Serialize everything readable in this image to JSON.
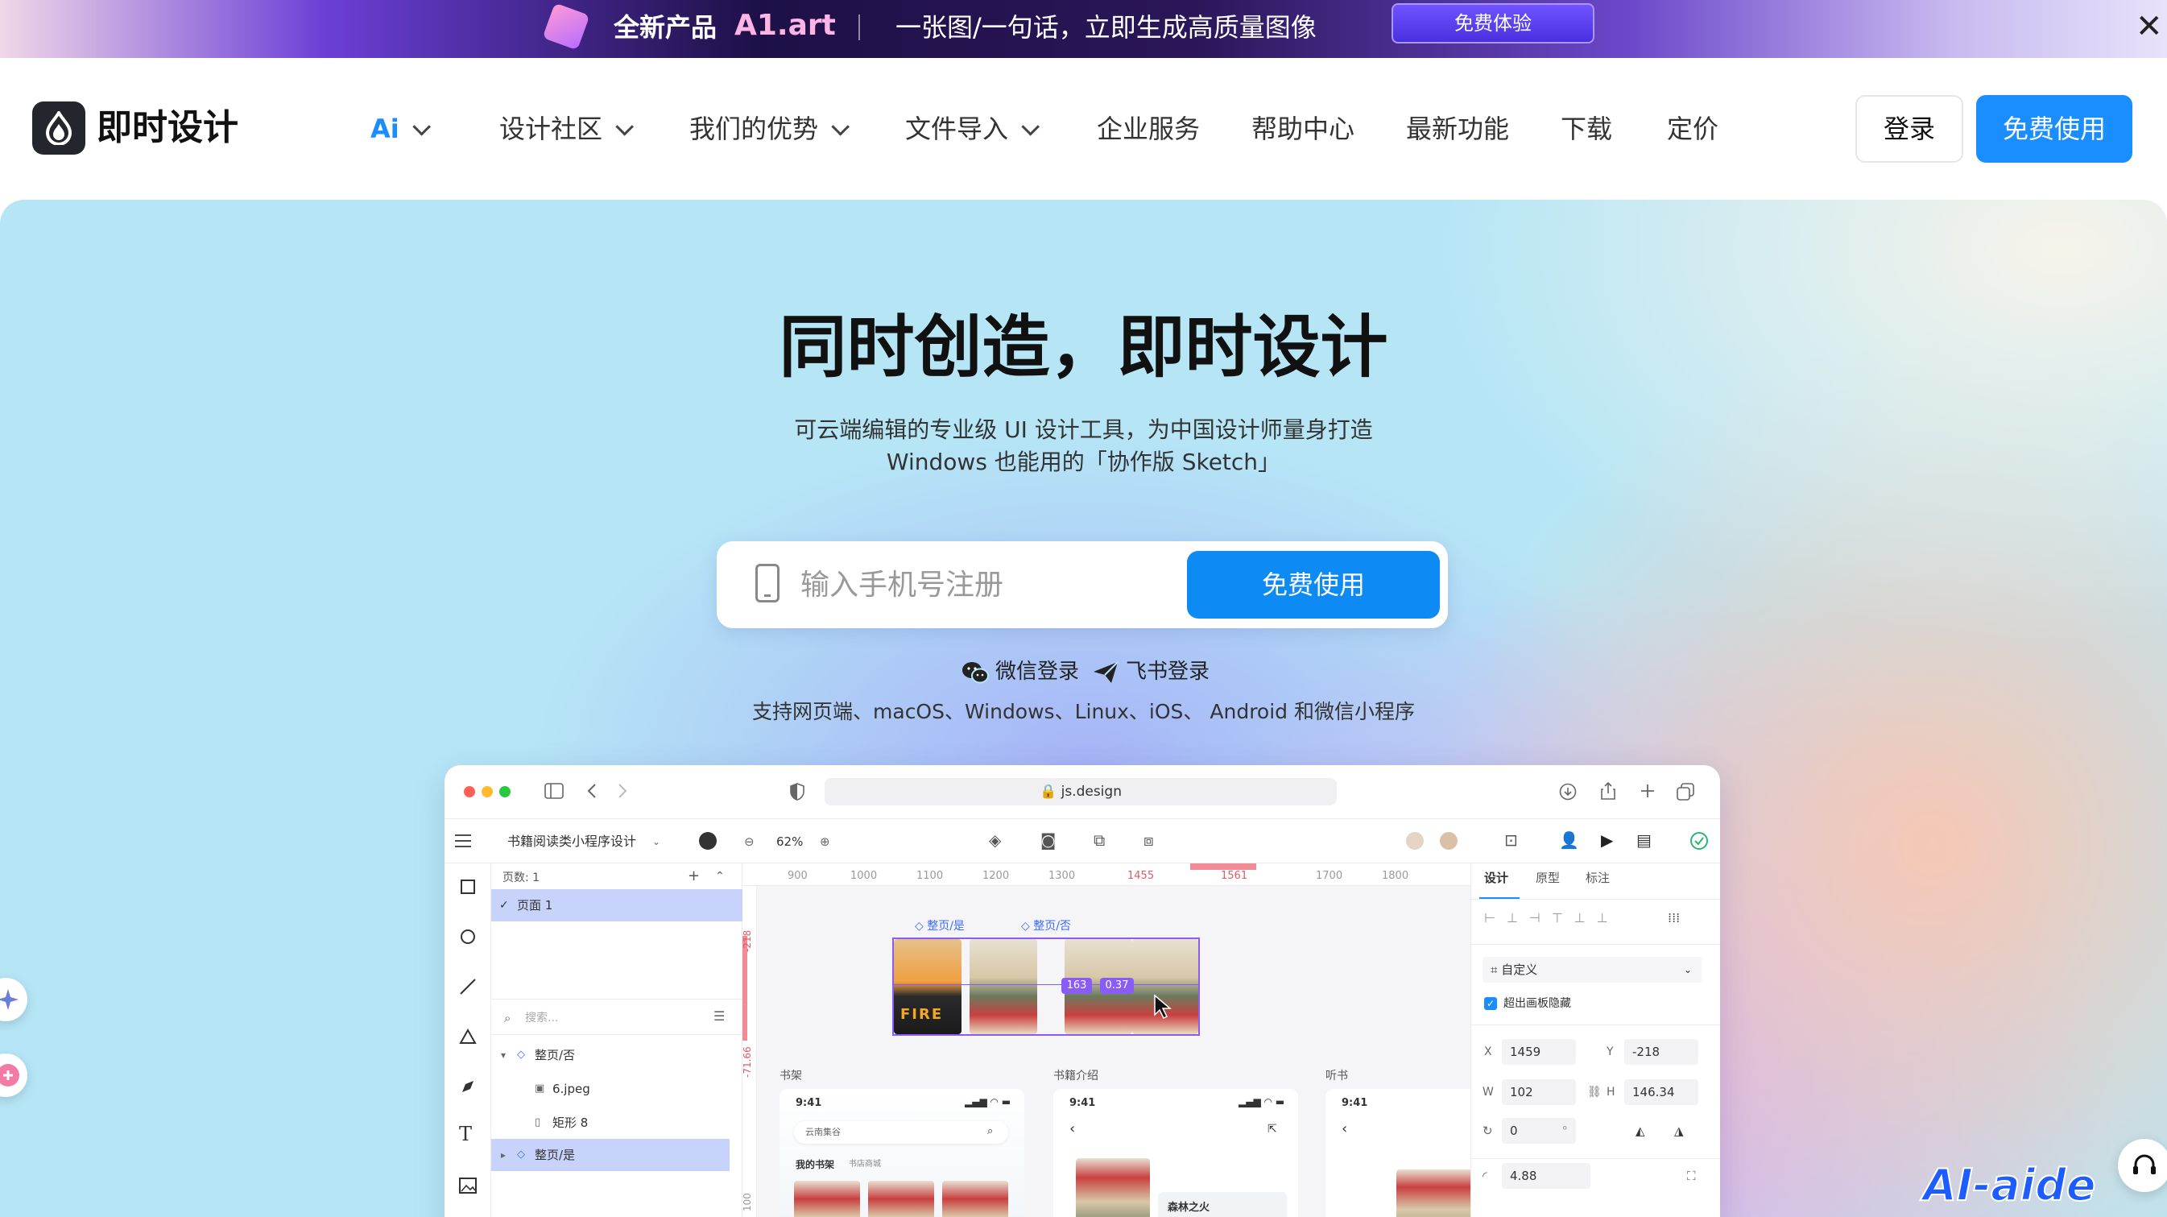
{
  "promo": {
    "new_product": "全新产品",
    "product_name": "A1.art",
    "tagline": "一张图/一句话，立即生成高质量图像",
    "trial_button": "免费体验",
    "close": "✕"
  },
  "nav": {
    "brand": "即时设计",
    "items": [
      {
        "label": "Ai"
      },
      {
        "label": "设计社区"
      },
      {
        "label": "我们的优势"
      },
      {
        "label": "文件导入"
      },
      {
        "label": "企业服务"
      },
      {
        "label": "帮助中心"
      },
      {
        "label": "最新功能"
      },
      {
        "label": "下载"
      },
      {
        "label": "定价"
      }
    ],
    "login": "登录",
    "free_use": "免费使用"
  },
  "hero": {
    "title": "同时创造，即时设计",
    "subtitle_line1": "可云端编辑的专业级 UI 设计工具，为中国设计师量身打造",
    "subtitle_line2": "Windows 也能用的「协作版 Sketch」",
    "phone_placeholder": "输入手机号注册",
    "cta": "免费使用",
    "wechat_login": "微信登录",
    "feishu_login": "飞书登录",
    "platforms": "支持网页端、macOS、Windows、Linux、iOS、 Android 和微信小程序"
  },
  "mockup": {
    "url": "js.design",
    "file_name": "书籍阅读类小程序设计",
    "zoom": "62%",
    "pages_label": "页数: 1",
    "page1": "页面 1",
    "search_placeholder": "搜索...",
    "layers": [
      "整页/否",
      "6.jpeg",
      "矩形 8",
      "整页/是"
    ],
    "ruler_ticks": [
      "900",
      "1000",
      "1100",
      "1200",
      "1300",
      "1455",
      "1561",
      "1700",
      "1800"
    ],
    "vruler": [
      "-218",
      "-71.66",
      "100"
    ],
    "frame_labels": [
      "整页/是",
      "整页/否"
    ],
    "size_badge_w": "163",
    "size_badge_h": "0.37",
    "section_labels": [
      "书架",
      "书籍介绍",
      "听书"
    ],
    "phone_time": "9:41",
    "phone_search": "云南集谷",
    "my_shelf": "我的书架",
    "book_city": "书店商城",
    "book_title": "森林之火",
    "fire_text": "FIRE",
    "props_tabs": [
      "设计",
      "原型",
      "标注"
    ],
    "custom": "自定义",
    "clip_content": "超出画板隐藏",
    "x_label": "X",
    "x_value": "1459",
    "y_label": "Y",
    "y_value": "-218",
    "w_label": "W",
    "w_value": "102",
    "h_label": "H",
    "h_value": "146.34",
    "rotation": "0",
    "rotation_unit": "°",
    "radius": "4.88"
  },
  "watermark": "AI-aide",
  "colors": {
    "primary": "#1a8dff",
    "cta": "#0e8af5",
    "selection": "#c8d3fb",
    "accent_purple": "#8a5cf6"
  }
}
